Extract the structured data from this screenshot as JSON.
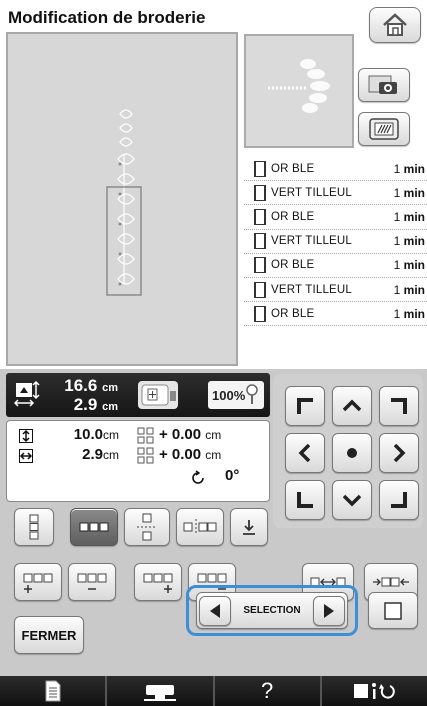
{
  "header": {
    "title": "Modification de broderie"
  },
  "threads": [
    {
      "name": "OR BLE",
      "time": "1",
      "unit": "min"
    },
    {
      "name": "VERT TILLEUL",
      "time": "1",
      "unit": "min"
    },
    {
      "name": "OR BLE",
      "time": "1",
      "unit": "min"
    },
    {
      "name": "VERT TILLEUL",
      "time": "1",
      "unit": "min"
    },
    {
      "name": "OR BLE",
      "time": "1",
      "unit": "min"
    },
    {
      "name": "VERT TILLEUL",
      "time": "1",
      "unit": "min"
    },
    {
      "name": "OR BLE",
      "time": "1",
      "unit": "min"
    }
  ],
  "size": {
    "width": "16.6",
    "height": "2.9",
    "unit": "cm",
    "zoom": "100%"
  },
  "info": {
    "height_value": "10.0",
    "height_unit": "cm",
    "width_value": "2.9",
    "width_unit": "cm",
    "offset_x": "+ 0.00",
    "offset_x_unit": "cm",
    "offset_y": "+ 0.00",
    "offset_y_unit": "cm",
    "rotation": "0°"
  },
  "buttons": {
    "close": "FERMER",
    "selection": "SELECTION"
  },
  "colors": {
    "accent": "#3b8fd6",
    "panel": "#c9c9c9",
    "bar": "#1c1c1c"
  }
}
